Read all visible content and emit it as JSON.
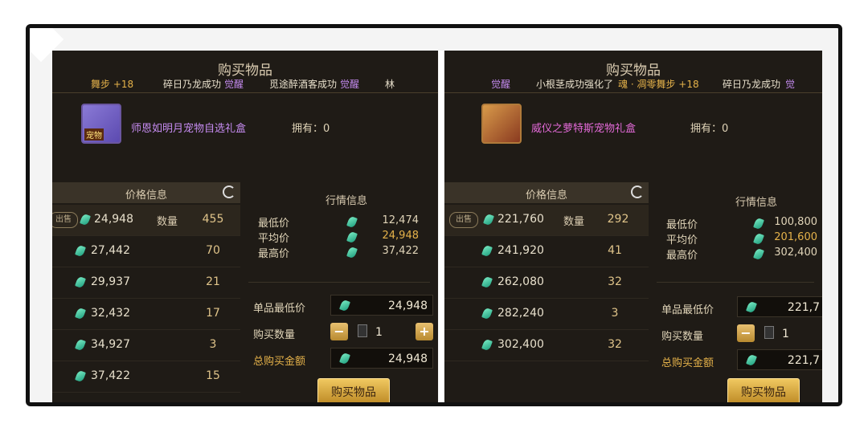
{
  "left": {
    "title": "购买物品",
    "ticker": [
      "舞步 +18",
      "碎日乃龙成功",
      "觉醒",
      "觅途醉酒客成功",
      "觉醒",
      "林"
    ],
    "item": {
      "name": "师恩如明月宠物自选礼盒",
      "tag": "宠物",
      "owned_label": "拥有：0"
    },
    "price_header": "价格信息",
    "market_header": "行情信息",
    "sell_badge": "出售",
    "quantity_label": "数量",
    "rows": [
      {
        "price": "24,948",
        "qty": "455"
      },
      {
        "price": "27,442",
        "qty": "70"
      },
      {
        "price": "29,937",
        "qty": "21"
      },
      {
        "price": "32,432",
        "qty": "17"
      },
      {
        "price": "34,927",
        "qty": "3"
      },
      {
        "price": "37,422",
        "qty": "15"
      }
    ],
    "stats": {
      "min_label": "最低价",
      "min": "12,474",
      "avg_label": "平均价",
      "avg": "24,948",
      "max_label": "最高价",
      "max": "37,422"
    },
    "form": {
      "unit_min_label": "单品最低价",
      "unit_min": "24,948",
      "qty_label": "购买数量",
      "qty": "1",
      "total_label": "总购买金额",
      "total": "24,948"
    },
    "buy_button": "购买物品"
  },
  "right": {
    "title": "购买物品",
    "ticker": [
      "觉醒",
      "小根茎成功强化了",
      "魂 · 凋零舞步 +18",
      "碎日乃龙成功",
      "觉"
    ],
    "item": {
      "name": "威仪之萝特斯宠物礼盒",
      "owned_label": "拥有：0"
    },
    "price_header": "价格信息",
    "market_header": "行情信息",
    "sell_badge": "出售",
    "quantity_label": "数量",
    "rows": [
      {
        "price": "221,760",
        "qty": "292"
      },
      {
        "price": "241,920",
        "qty": "41"
      },
      {
        "price": "262,080",
        "qty": "32"
      },
      {
        "price": "282,240",
        "qty": "3"
      },
      {
        "price": "302,400",
        "qty": "32"
      }
    ],
    "stats": {
      "min_label": "最低价",
      "min": "100,800",
      "avg_label": "平均价",
      "avg": "201,600",
      "max_label": "最高价",
      "max": "302,400"
    },
    "form": {
      "unit_min_label": "单品最低价",
      "unit_min": "221,7",
      "qty_label": "购买数量",
      "qty": "1",
      "total_label": "总购买金额",
      "total": "221,7"
    },
    "buy_button": "购买物品"
  }
}
